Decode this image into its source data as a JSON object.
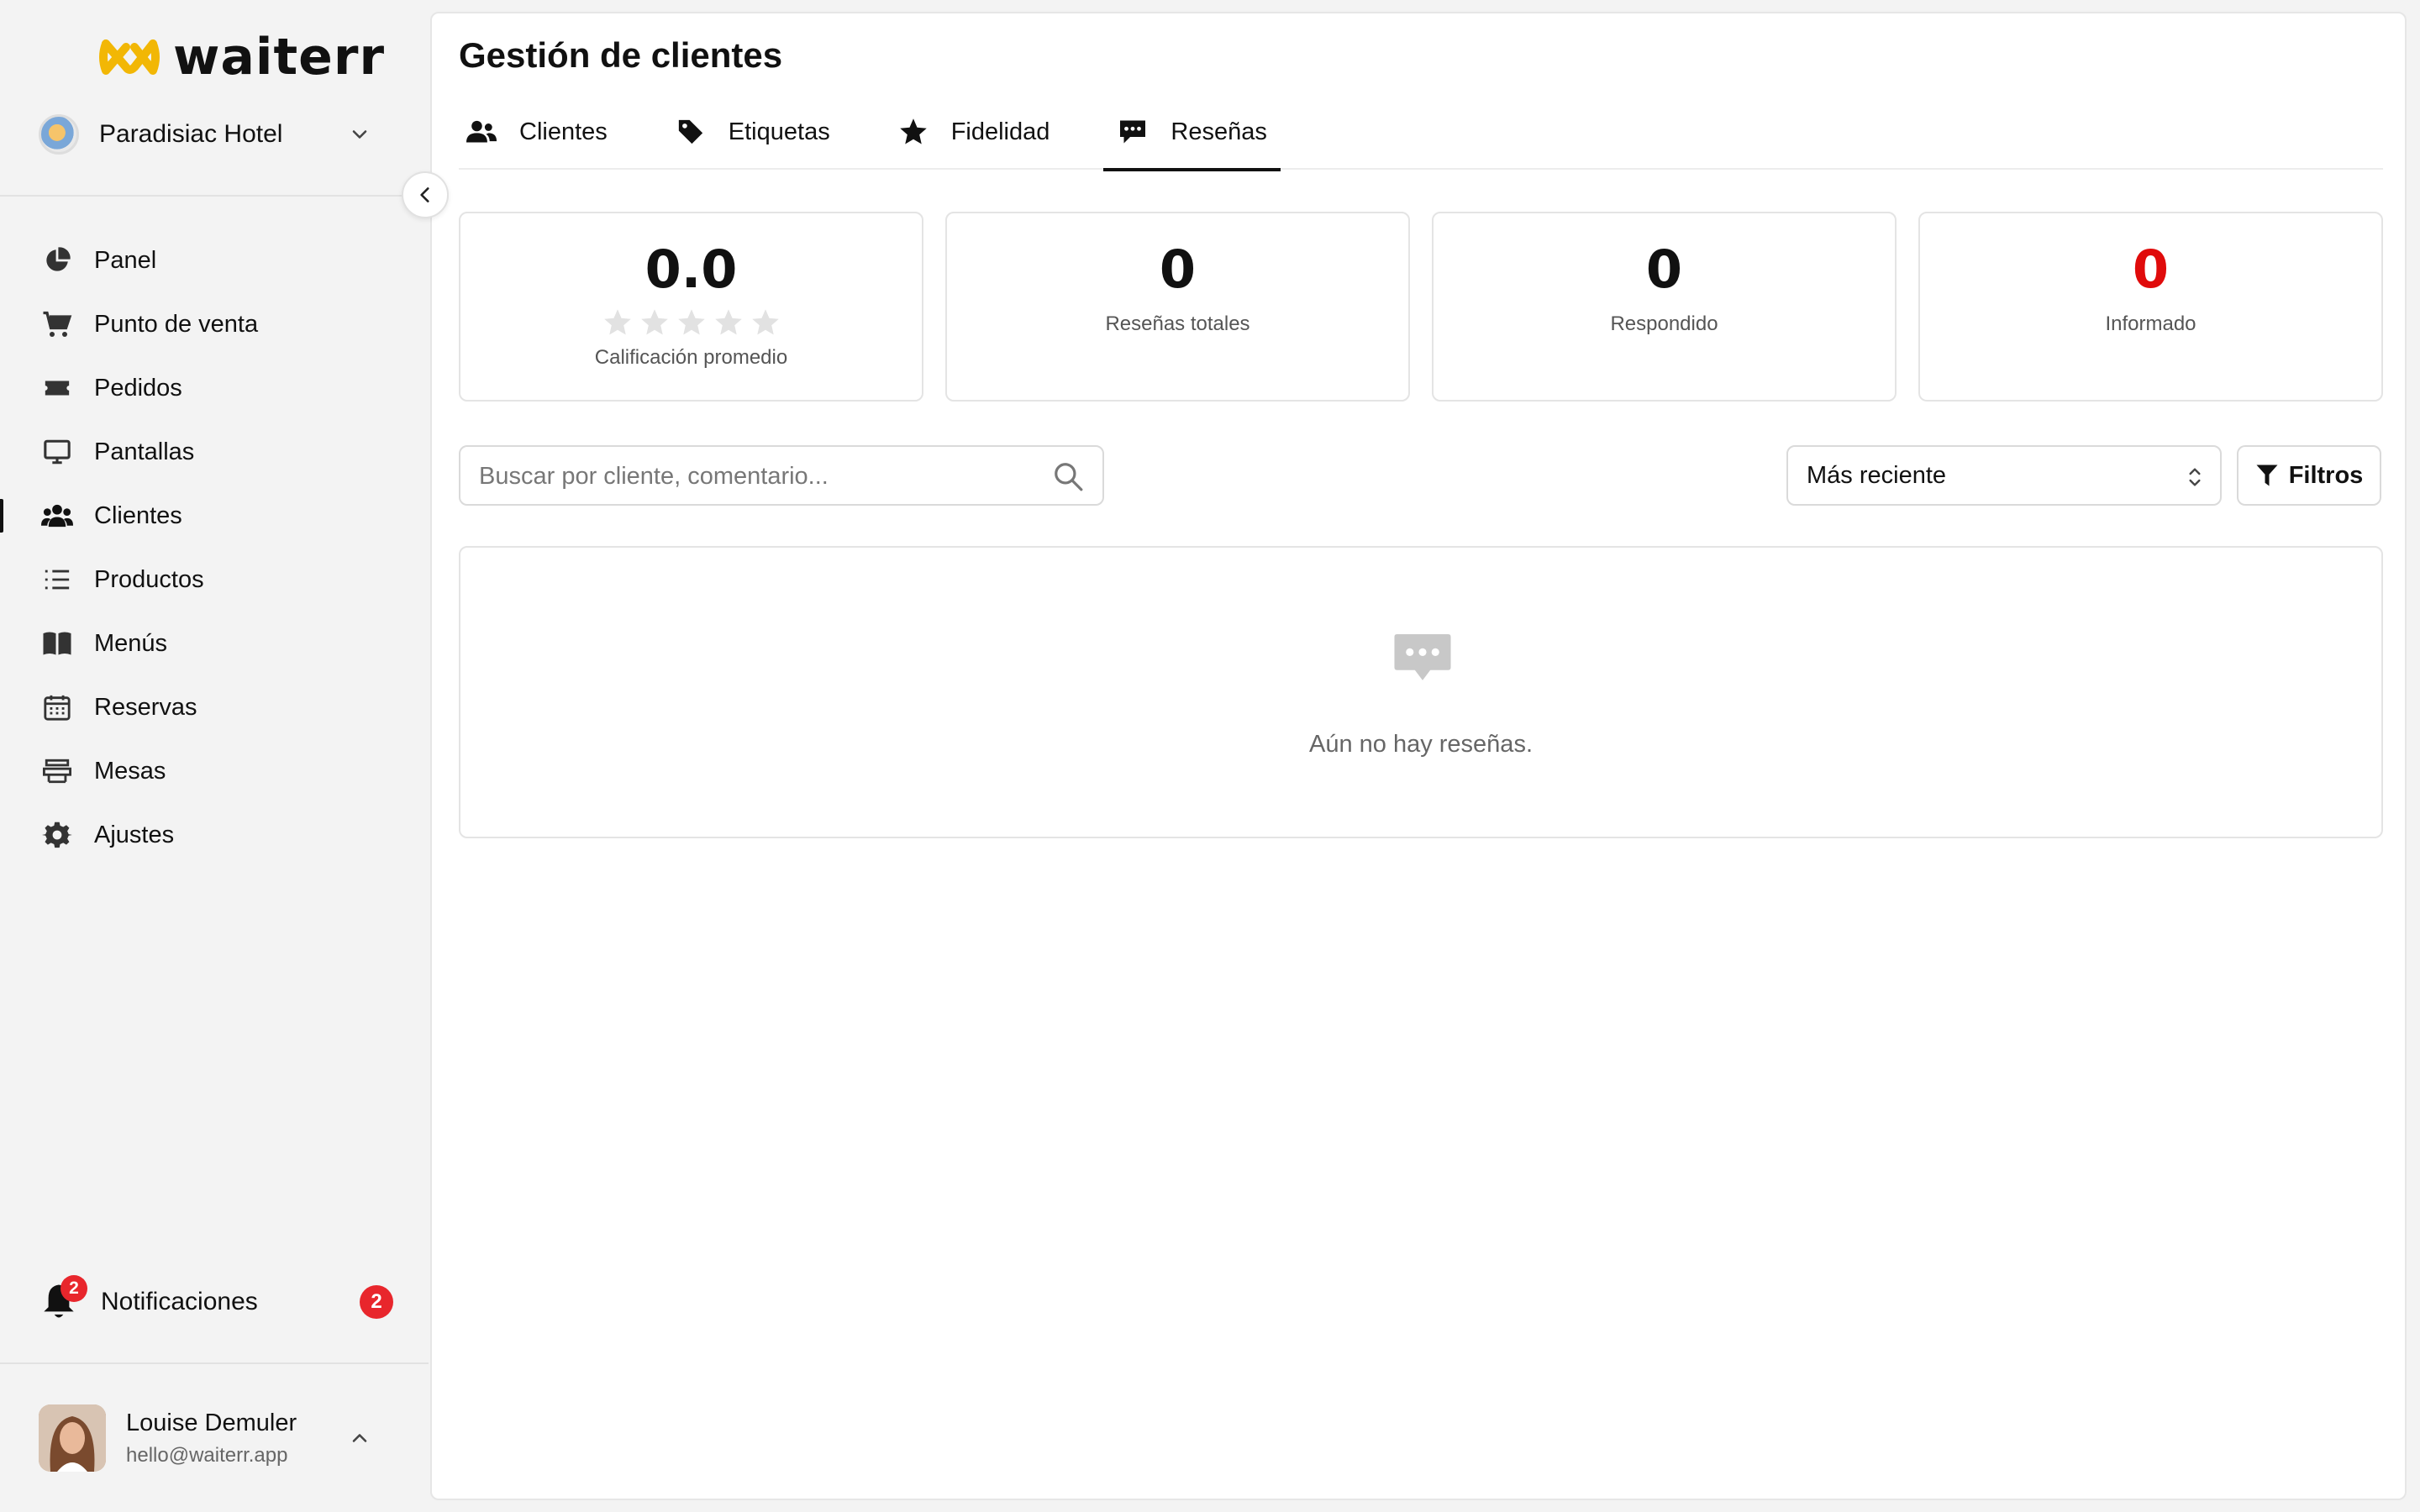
{
  "app": {
    "name": "waiterr",
    "venue": "Paradisiac Hotel"
  },
  "sidebar": {
    "items": [
      {
        "label": "Panel",
        "icon": "pie-chart-icon"
      },
      {
        "label": "Punto de venta",
        "icon": "cart-icon"
      },
      {
        "label": "Pedidos",
        "icon": "ticket-icon"
      },
      {
        "label": "Pantallas",
        "icon": "monitor-icon"
      },
      {
        "label": "Clientes",
        "icon": "users-icon",
        "active": true
      },
      {
        "label": "Productos",
        "icon": "list-icon"
      },
      {
        "label": "Menús",
        "icon": "book-icon"
      },
      {
        "label": "Reservas",
        "icon": "calendar-icon"
      },
      {
        "label": "Mesas",
        "icon": "table-icon"
      },
      {
        "label": "Ajustes",
        "icon": "gear-icon"
      }
    ],
    "notifications": {
      "label": "Notificaciones",
      "count": "2"
    },
    "user": {
      "name": "Louise Demuler",
      "email": "hello@waiterr.app"
    }
  },
  "main": {
    "title": "Gestión de clientes",
    "tabs": [
      {
        "label": "Clientes",
        "icon": "users-icon"
      },
      {
        "label": "Etiquetas",
        "icon": "tag-icon"
      },
      {
        "label": "Fidelidad",
        "icon": "star-icon"
      },
      {
        "label": "Reseñas",
        "icon": "chat-icon",
        "active": true
      }
    ],
    "stats": [
      {
        "value": "0.0",
        "label": "Calificación promedio",
        "stars_filled": 0,
        "stars_total": 5
      },
      {
        "value": "0",
        "label": "Reseñas totales"
      },
      {
        "value": "0",
        "label": "Respondido"
      },
      {
        "value": "0",
        "label": "Informado",
        "color": "#e00b0b"
      }
    ],
    "search": {
      "placeholder": "Buscar por cliente, comentario...",
      "value": ""
    },
    "sort": {
      "value": "Más reciente"
    },
    "filters": {
      "label": "Filtros"
    },
    "empty": {
      "text": "Aún no hay reseñas."
    }
  },
  "colors": {
    "accent": "#f2b705",
    "badge": "#e8262c",
    "danger": "#e00b0b",
    "text": "#111111"
  }
}
